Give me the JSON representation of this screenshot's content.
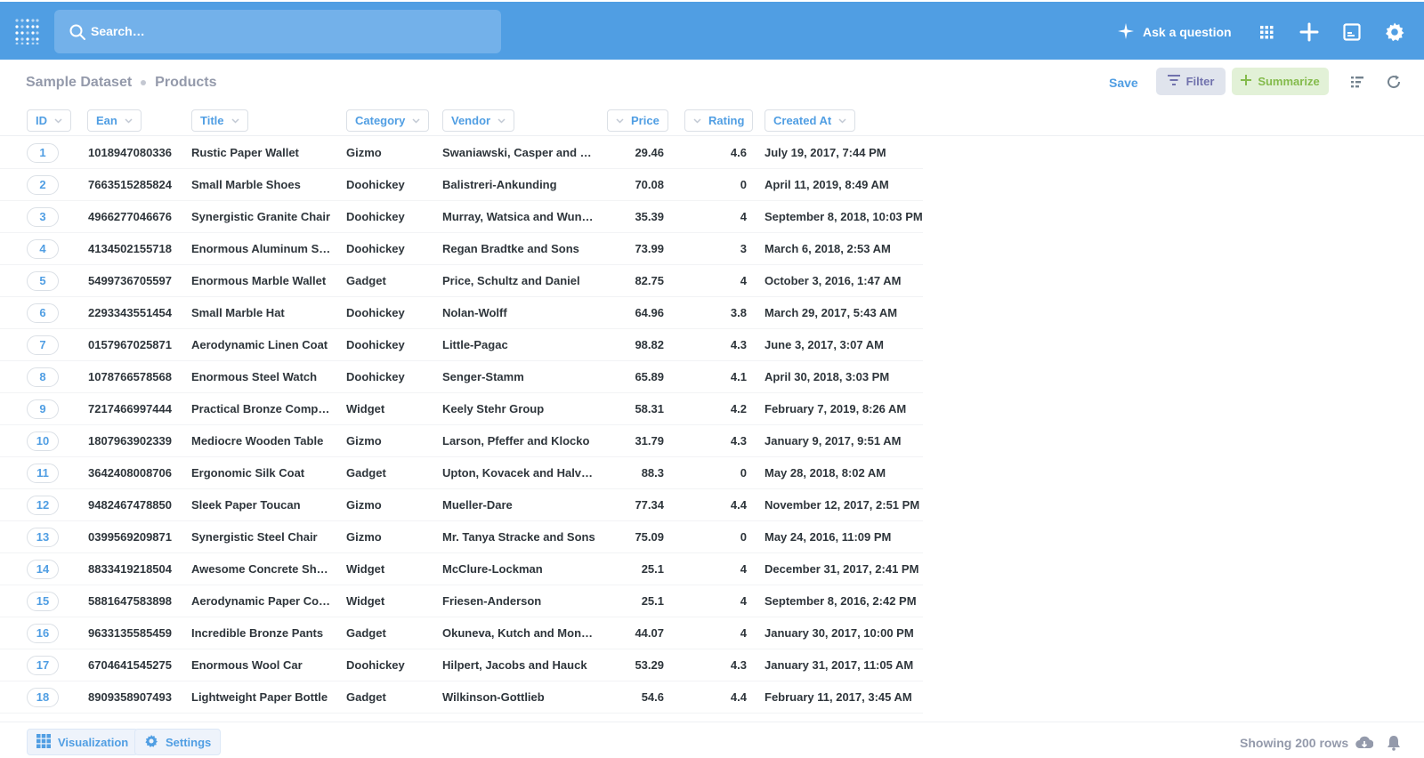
{
  "nav": {
    "search_placeholder": "Search…",
    "ask_label": "Ask a question",
    "icons": [
      "logo-icon",
      "search-icon",
      "sparkle-icon",
      "grid-icon",
      "plus-icon",
      "console-icon",
      "gear-icon"
    ]
  },
  "header": {
    "breadcrumb_db": "Sample Dataset",
    "breadcrumb_table": "Products",
    "save_label": "Save",
    "filter_label": "Filter",
    "summarize_label": "Summarize"
  },
  "columns": [
    "ID",
    "Ean",
    "Title",
    "Category",
    "Vendor",
    "Price",
    "Rating",
    "Created At"
  ],
  "rows": [
    [
      "1",
      "1018947080336",
      "Rustic Paper Wallet",
      "Gizmo",
      "Swaniawski, Casper and Hilll",
      "29.46",
      "4.6",
      "July 19, 2017, 7:44 PM"
    ],
    [
      "2",
      "7663515285824",
      "Small Marble Shoes",
      "Doohickey",
      "Balistreri-Ankunding",
      "70.08",
      "0",
      "April 11, 2019, 8:49 AM"
    ],
    [
      "3",
      "4966277046676",
      "Synergistic Granite Chair",
      "Doohickey",
      "Murray, Watsica and Wunsch",
      "35.39",
      "4",
      "September 8, 2018, 10:03 PM"
    ],
    [
      "4",
      "4134502155718",
      "Enormous Aluminum Shirt",
      "Doohickey",
      "Regan Bradtke and Sons",
      "73.99",
      "3",
      "March 6, 2018, 2:53 AM"
    ],
    [
      "5",
      "5499736705597",
      "Enormous Marble Wallet",
      "Gadget",
      "Price, Schultz and Daniel",
      "82.75",
      "4",
      "October 3, 2016, 1:47 AM"
    ],
    [
      "6",
      "2293343551454",
      "Small Marble Hat",
      "Doohickey",
      "Nolan-Wolff",
      "64.96",
      "3.8",
      "March 29, 2017, 5:43 AM"
    ],
    [
      "7",
      "0157967025871",
      "Aerodynamic Linen Coat",
      "Doohickey",
      "Little-Pagac",
      "98.82",
      "4.3",
      "June 3, 2017, 3:07 AM"
    ],
    [
      "8",
      "1078766578568",
      "Enormous Steel Watch",
      "Doohickey",
      "Senger-Stamm",
      "65.89",
      "4.1",
      "April 30, 2018, 3:03 PM"
    ],
    [
      "9",
      "7217466997444",
      "Practical Bronze Computer",
      "Widget",
      "Keely Stehr Group",
      "58.31",
      "4.2",
      "February 7, 2019, 8:26 AM"
    ],
    [
      "10",
      "1807963902339",
      "Mediocre Wooden Table",
      "Gizmo",
      "Larson, Pfeffer and Klocko",
      "31.79",
      "4.3",
      "January 9, 2017, 9:51 AM"
    ],
    [
      "11",
      "3642408008706",
      "Ergonomic Silk Coat",
      "Gadget",
      "Upton, Kovacek and Halvor…",
      "88.3",
      "0",
      "May 28, 2018, 8:02 AM"
    ],
    [
      "12",
      "9482467478850",
      "Sleek Paper Toucan",
      "Gizmo",
      "Mueller-Dare",
      "77.34",
      "4.4",
      "November 12, 2017, 2:51 PM"
    ],
    [
      "13",
      "0399569209871",
      "Synergistic Steel Chair",
      "Gizmo",
      "Mr. Tanya Stracke and Sons",
      "75.09",
      "0",
      "May 24, 2016, 11:09 PM"
    ],
    [
      "14",
      "8833419218504",
      "Awesome Concrete Shoes",
      "Widget",
      "McClure-Lockman",
      "25.1",
      "4",
      "December 31, 2017, 2:41 PM"
    ],
    [
      "15",
      "5881647583898",
      "Aerodynamic Paper Com…",
      "Widget",
      "Friesen-Anderson",
      "25.1",
      "4",
      "September 8, 2016, 2:42 PM"
    ],
    [
      "16",
      "9633135585459",
      "Incredible Bronze Pants",
      "Gadget",
      "Okuneva, Kutch and Mona…",
      "44.07",
      "4",
      "January 30, 2017, 10:00 PM"
    ],
    [
      "17",
      "6704641545275",
      "Enormous Wool Car",
      "Doohickey",
      "Hilpert, Jacobs and Hauck",
      "53.29",
      "4.3",
      "January 31, 2017, 11:05 AM"
    ],
    [
      "18",
      "8909358907493",
      "Lightweight Paper Bottle",
      "Gadget",
      "Wilkinson-Gottlieb",
      "54.6",
      "4.4",
      "February 11, 2017, 3:45 AM"
    ]
  ],
  "footer": {
    "visualization_label": "Visualization",
    "settings_label": "Settings",
    "showing_label": "Showing 200 rows"
  },
  "colors": {
    "brand": "#509ee3",
    "filter": "#7172ad",
    "summarize": "#84bb4c"
  }
}
